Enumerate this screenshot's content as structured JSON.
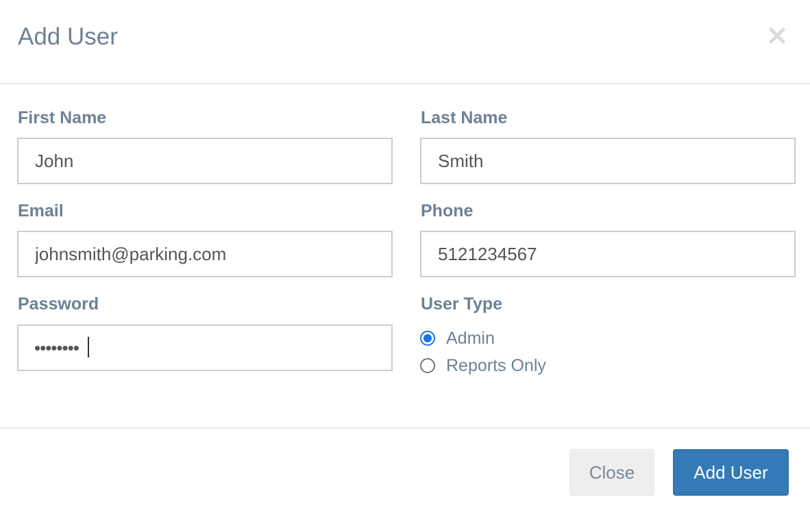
{
  "modal": {
    "title": "Add User",
    "close_icon": "close-icon"
  },
  "form": {
    "first_name": {
      "label": "First Name",
      "value": "John"
    },
    "last_name": {
      "label": "Last Name",
      "value": "Smith"
    },
    "email": {
      "label": "Email",
      "value": "johnsmith@parking.com"
    },
    "phone": {
      "label": "Phone",
      "value": "5121234567"
    },
    "password": {
      "label": "Password",
      "masked_value": "••••••••"
    },
    "user_type": {
      "label": "User Type",
      "options": [
        {
          "label": "Admin",
          "checked": true
        },
        {
          "label": "Reports Only",
          "checked": false
        }
      ]
    }
  },
  "footer": {
    "close_label": "Close",
    "add_label": "Add User"
  },
  "colors": {
    "primary": "#337ab7",
    "label_text": "#6e8195",
    "radio_accent": "#1a73e8"
  }
}
